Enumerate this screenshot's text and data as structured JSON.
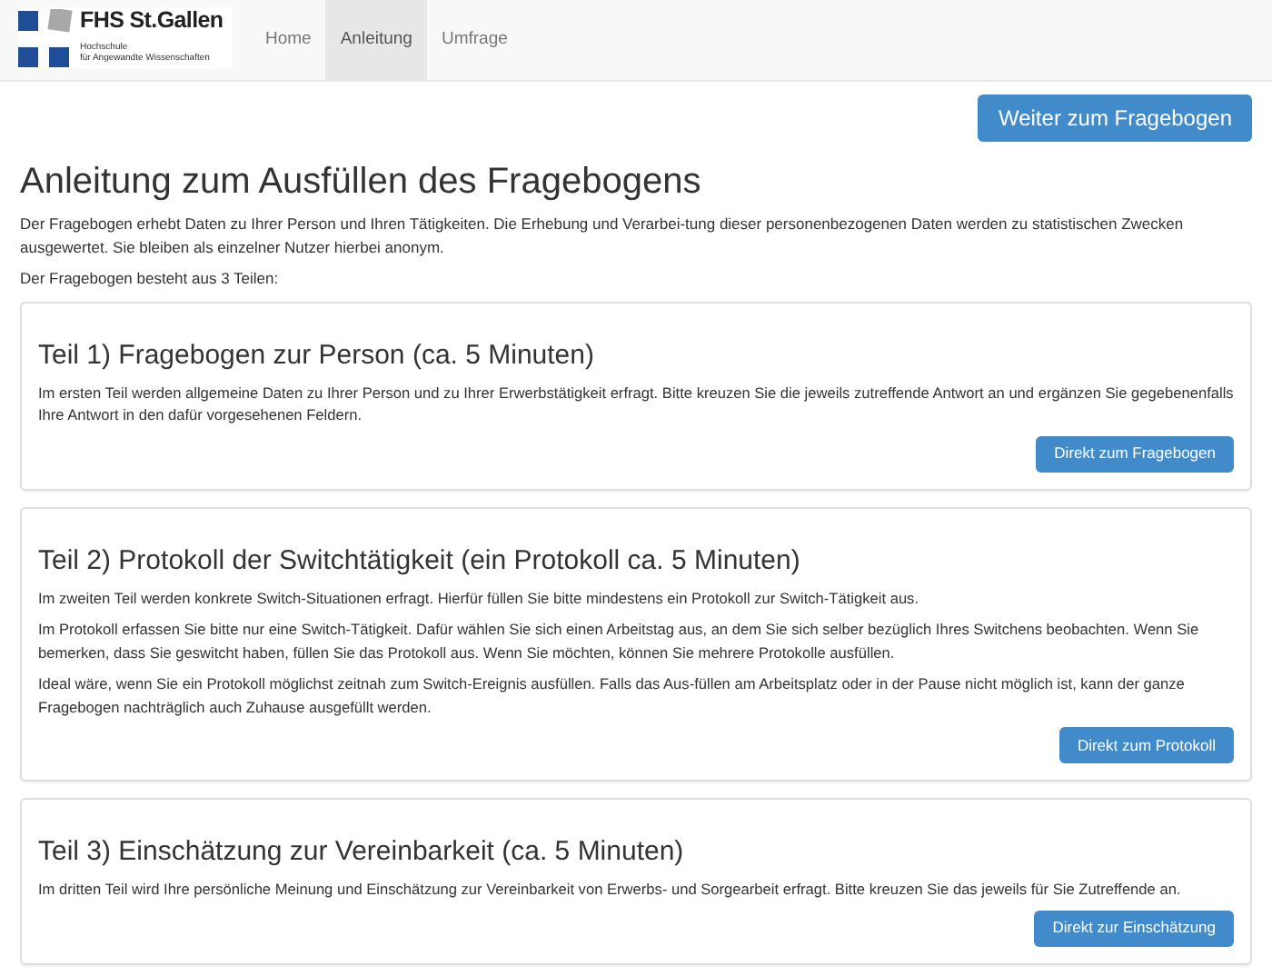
{
  "logo": {
    "title": "FHS St.Gallen",
    "subtitle": [
      "Hochschule",
      "für Angewandte Wissenschaften"
    ]
  },
  "nav": [
    {
      "label": "Home",
      "selected": false
    },
    {
      "label": "Anleitung",
      "selected": true
    },
    {
      "label": "Umfrage",
      "selected": false
    }
  ],
  "top_button": "Weiter zum Fragebogen",
  "title": "Anleitung zum Ausfüllen des Fragebogens",
  "intro": [
    "Der Fragebogen erhebt Daten zu Ihrer Person und Ihren Tätigkeiten. Die Erhebung und Verarbei-tung dieser personenbezogenen Daten werden zu statistischen Zwecken ausgewertet. Sie bleiben als einzelner Nutzer hierbei anonym.",
    "Der Fragebogen besteht aus 3 Teilen:"
  ],
  "parts": [
    {
      "title": "Teil 1) Fragebogen zur Person (ca. 5 Minuten)",
      "paragraphs": [
        "Im ersten Teil werden allgemeine Daten zu Ihrer Person und zu Ihrer Erwerbstätigkeit erfragt. Bitte kreuzen Sie die jeweils zutreffende Antwort an und ergänzen Sie gegebenenfalls Ihre Antwort in den dafür vorgesehenen Feldern."
      ],
      "button": "Direkt zum Fragebogen"
    },
    {
      "title": "Teil 2) Protokoll der Switchtätigkeit (ein Protokoll ca. 5 Minuten)",
      "paragraphs": [
        "Im zweiten Teil werden konkrete Switch-Situationen erfragt. Hierfür füllen Sie bitte mindestens ein Protokoll zur Switch-Tätigkeit aus.",
        "Im Protokoll erfassen Sie bitte nur eine Switch-Tätigkeit. Dafür wählen Sie sich einen Arbeitstag aus, an dem Sie sich selber bezüglich Ihres Switchens beobachten. Wenn Sie bemerken, dass Sie geswitcht haben, füllen Sie das Protokoll aus. Wenn Sie möchten, können Sie mehrere Protokolle ausfüllen.",
        "Ideal wäre, wenn Sie ein Protokoll möglichst zeitnah zum Switch-Ereignis ausfüllen. Falls das Aus-füllen am Arbeitsplatz oder in der Pause nicht möglich ist, kann der ganze Fragebogen nachträglich auch Zuhause ausgefüllt werden."
      ],
      "button": "Direkt zum Protokoll"
    },
    {
      "title": "Teil 3) Einschätzung zur Vereinbarkeit (ca. 5 Minuten)",
      "paragraphs": [
        "Im dritten Teil wird Ihre persönliche Meinung und Einschätzung zur Vereinbarkeit von Erwerbs- und Sorgearbeit erfragt. Bitte kreuzen Sie das jeweils für Sie Zutreffende an."
      ],
      "button": "Direkt zur Einschätzung"
    }
  ]
}
